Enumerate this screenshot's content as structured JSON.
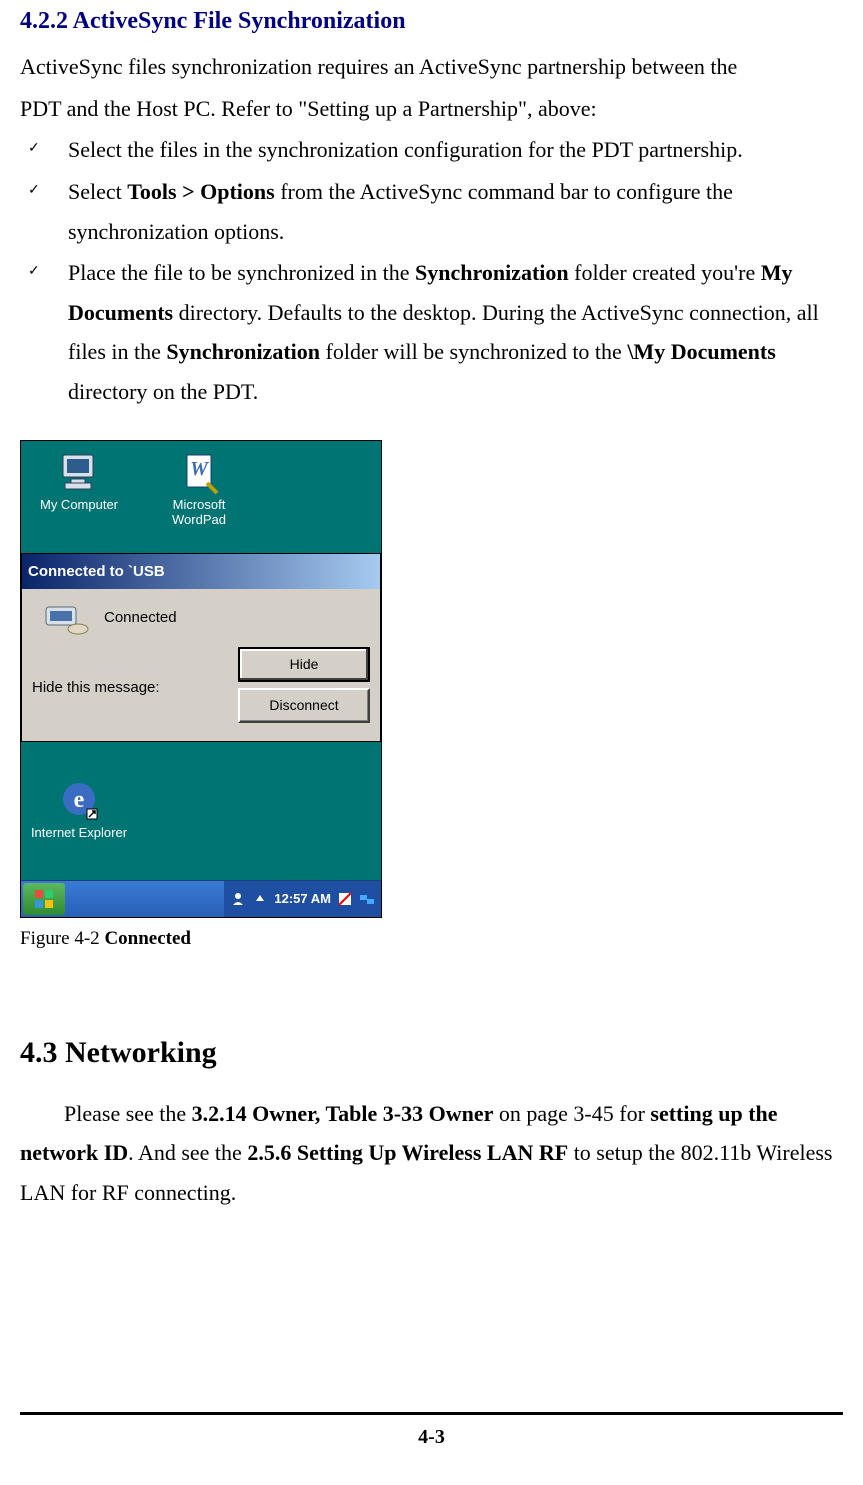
{
  "section422": {
    "heading": "4.2.2 ActiveSync File Synchronization",
    "intro_a": "  ActiveSync files synchronization requires an ActiveSync partnership between the",
    "intro_b": "PDT and the Host PC. Refer to \"Setting up a Partnership\", above:",
    "bullets": {
      "b1": "Select the files in the synchronization configuration for the PDT partnership.",
      "b2_pre": "Select ",
      "b2_bold": "Tools > Options",
      "b2_post": " from the ActiveSync command bar to configure the synchronization options.",
      "b3_pre": "Place the file to be synchronized in the ",
      "b3_bold1": "Synchronization",
      "b3_mid1": " folder created you're ",
      "b3_bold2": "My Documents",
      "b3_mid2": " directory. Defaults to the desktop. During the ActiveSync connection, all files in the ",
      "b3_bold3": "Synchronization",
      "b3_mid3": " folder will be synchronized to the ",
      "b3_bold4": "\\My Documents",
      "b3_post": " directory on the PDT."
    }
  },
  "screenshot": {
    "icons": {
      "my_computer": "My Computer",
      "wordpad": "Microsoft WordPad",
      "ie": "Internet Explorer"
    },
    "dialog": {
      "title": "Connected to `USB",
      "status": "Connected",
      "hide_label": "Hide this message:",
      "hide_btn": "Hide",
      "disconnect_btn": "Disconnect"
    },
    "taskbar": {
      "time": "12:57 AM"
    }
  },
  "figure_caption_pre": "Figure 4-2 ",
  "figure_caption_bold": "Connected",
  "section43": {
    "heading": "4.3 Networking",
    "p_pre": "Please see the ",
    "p_bold1": "3.2.14 Owner, Table 3-33 Owner",
    "p_mid1": " on page 3-45 for ",
    "p_bold2": "setting up the network ID",
    "p_mid2": ". And see the ",
    "p_bold3": "2.5.6 Setting Up Wireless LAN RF",
    "p_post": " to setup the 802.11b Wireless LAN for RF connecting."
  },
  "page_number": "4-3"
}
